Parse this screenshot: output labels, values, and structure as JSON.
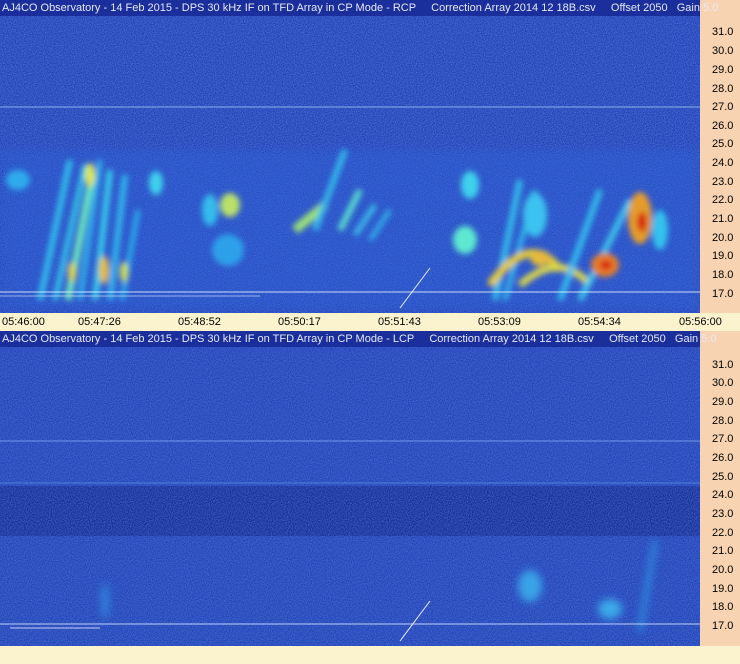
{
  "panels": [
    {
      "id": "rcp",
      "title": "AJ4CO Observatory - 14 Feb 2015 - DPS 30 kHz IF on TFD Array in CP Mode - RCP     Correction Array 2014 12 18B.csv     Offset 2050   Gain 5.0",
      "freq_labels": [
        "31.0",
        "30.0",
        "29.0",
        "28.0",
        "27.0",
        "26.0",
        "25.0",
        "24.0",
        "23.0",
        "22.0",
        "21.0",
        "20.0",
        "19.0",
        "18.0",
        "17.0"
      ],
      "time_labels": [
        "05:46:00",
        "05:47:26",
        "05:48:52",
        "05:50:17",
        "05:51:43",
        "05:53:09",
        "05:54:34",
        "05:56:00"
      ]
    },
    {
      "id": "lcp",
      "title": "AJ4CO Observatory - 14 Feb 2015 - DPS 30 kHz IF on TFD Array in CP Mode - LCP     Correction Array 2014 12 18B.csv     Offset 2050   Gain 5.0",
      "freq_labels": [
        "31.0",
        "30.0",
        "29.0",
        "28.0",
        "27.0",
        "26.0",
        "25.0",
        "24.0",
        "23.0",
        "22.0",
        "21.0",
        "20.0",
        "19.0",
        "18.0",
        "17.0"
      ],
      "time_labels": []
    }
  ],
  "colors": {
    "background": "#1f3fb8",
    "dark_noise": "#0b1a78",
    "light_noise": "#3d7ae0",
    "cyan": "#38e0f0",
    "yellow": "#f0f040",
    "red": "#e03010",
    "axis_bg": "#f7d3b2",
    "time_bg": "#fbf3cd"
  }
}
